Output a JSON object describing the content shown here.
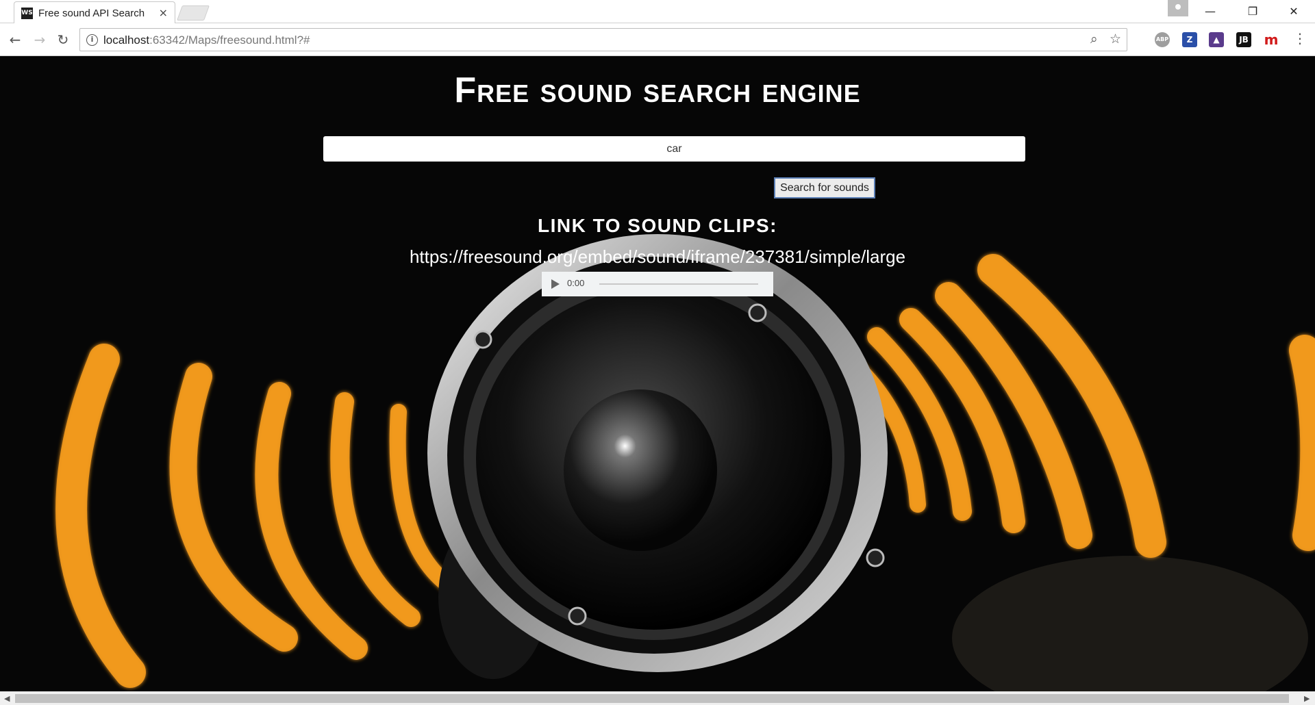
{
  "browser": {
    "tab_title": "Free sound API Search",
    "tab_favicon_text": "WS",
    "tab_close": "×",
    "window_controls": {
      "minimize": "—",
      "maximize": "❐",
      "close": "✕"
    },
    "nav": {
      "back": "←",
      "forward": "→",
      "reload": "↻"
    },
    "url_host": "localhost",
    "url_rest": ":63342/Maps/freesound.html?#",
    "info_icon": "i",
    "zoom_icon": "⌕",
    "bookmark_icon": "☆",
    "extensions": [
      {
        "name": "adblock-plus-extension",
        "text": "ABP",
        "color": "#9e9e9e"
      },
      {
        "name": "zotero-extension",
        "text": "Z",
        "color": "#2a4fa8"
      },
      {
        "name": "color-extension",
        "text": "▲",
        "color": "#5a3b8c"
      },
      {
        "name": "jetbrains-extension",
        "text": "JB",
        "color": "#111111"
      },
      {
        "name": "mendeley-extension",
        "text": "m",
        "color": "#d11b1b"
      }
    ],
    "menu_icon": "⋮"
  },
  "page": {
    "title": "Free sound search engine",
    "search_value": "car",
    "search_button_label": "Search for sounds",
    "subtitle": "LINK TO SOUND CLIPS:",
    "sound_link": "https://freesound.org/embed/sound/iframe/237381/simple/large",
    "player_time": "0:00",
    "accent_color": "#ff9a1a"
  },
  "scrollbar": {
    "left_arrow": "◀",
    "right_arrow": "▶"
  }
}
